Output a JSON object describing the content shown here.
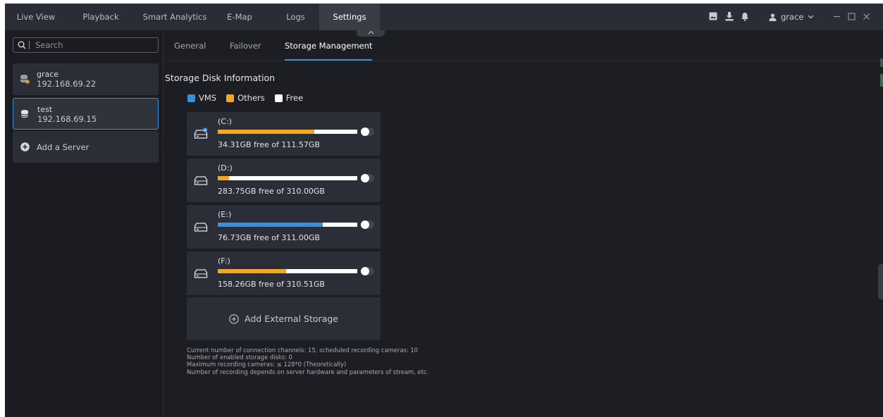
{
  "nav": {
    "tabs": [
      {
        "label": "Live View"
      },
      {
        "label": "Playback"
      },
      {
        "label": "Smart Analytics"
      },
      {
        "label": "E-Map"
      },
      {
        "label": "Logs"
      },
      {
        "label": "Settings"
      }
    ],
    "active_tab": "Settings",
    "user": "grace"
  },
  "sidebar": {
    "search_placeholder": "Search",
    "servers": [
      {
        "name": "grace",
        "ip": "192.168.69.22"
      },
      {
        "name": "test",
        "ip": "192.168.69.15"
      }
    ],
    "add_server_label": "Add a Server"
  },
  "subtabs": [
    {
      "label": "General"
    },
    {
      "label": "Failover"
    },
    {
      "label": "Storage Management"
    }
  ],
  "storage": {
    "title": "Storage Disk Information",
    "legend": [
      {
        "label": "VMS",
        "color": "#3c8fd6"
      },
      {
        "label": "Others",
        "color": "#f5a623"
      },
      {
        "label": "Free",
        "color": "#ffffff"
      }
    ],
    "disks": [
      {
        "drive": "(C:)",
        "free_text": "34.31GB free of 111.57GB",
        "used_fraction": 0.69,
        "usage_type": "Others",
        "bar_color": "#f5a623"
      },
      {
        "drive": "(D:)",
        "free_text": "283.75GB free of 310.00GB",
        "used_fraction": 0.08,
        "usage_type": "Others",
        "bar_color": "#f5a623"
      },
      {
        "drive": "(E:)",
        "free_text": "76.73GB free of 311.00GB",
        "used_fraction": 0.75,
        "usage_type": "VMS",
        "bar_color": "#3c8fd6"
      },
      {
        "drive": "(F:)",
        "free_text": "158.26GB free of 310.51GB",
        "used_fraction": 0.49,
        "usage_type": "Others",
        "bar_color": "#f5a623"
      }
    ],
    "add_external_label": "Add External Storage",
    "info": [
      "Current number of connection channels: 15, scheduled recording cameras: 10",
      "Number of enabled storage disks: 0",
      "Maximum recording cameras: ≤ 128*0 (Theoretically)",
      "Number of recording depends on server hardware and parameters of stream, etc."
    ]
  }
}
